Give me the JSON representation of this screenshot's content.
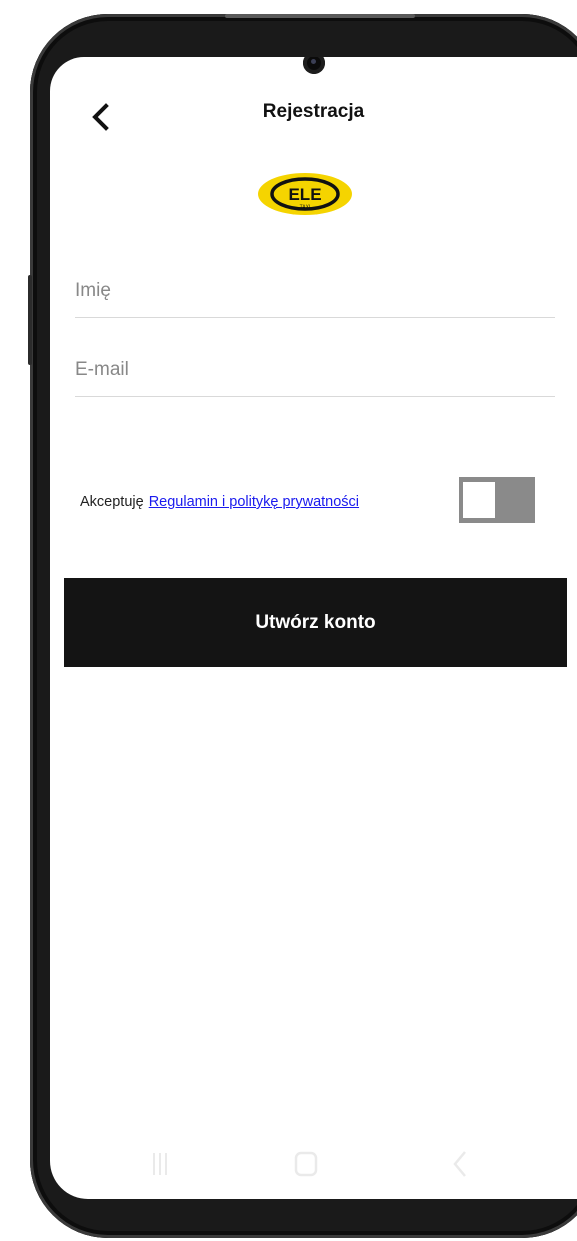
{
  "header": {
    "title": "Rejestracja",
    "back_icon": "chevron-left-icon"
  },
  "logo": {
    "text": "ELE",
    "subtext": "TAXI",
    "colors": {
      "yellow": "#f5d400",
      "dark": "#111111"
    }
  },
  "form": {
    "name_placeholder": "Imię",
    "name_value": "",
    "email_placeholder": "E-mail",
    "email_value": ""
  },
  "terms": {
    "prefix": "Akceptuję",
    "link_text": "Regulamin i politykę prywatności",
    "accepted": false
  },
  "actions": {
    "create_account_label": "Utwórz konto"
  },
  "navbar": {
    "icons": [
      "recents-icon",
      "home-icon",
      "back-icon"
    ]
  },
  "colors": {
    "button_bg": "#141414",
    "link": "#1a1aee",
    "toggle_off": "#8a8a8a"
  }
}
